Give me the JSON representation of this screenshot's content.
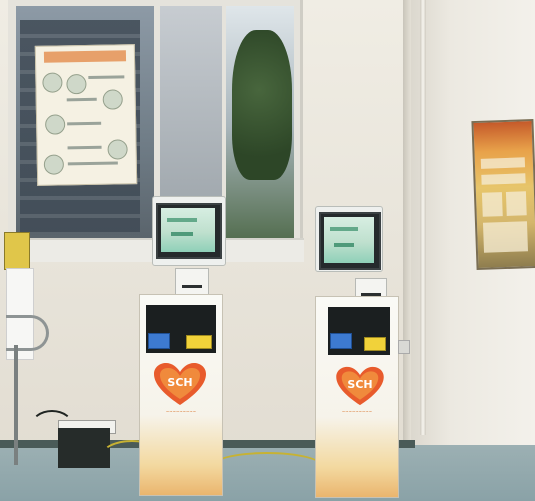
{
  "scene": {
    "description_label": "Hospital self-service kiosks",
    "colors": {
      "wall": "#ece9e1",
      "floor": "#8fa6ab",
      "kiosk_body": "#f8f6ee",
      "kiosk_wave": "#eab56e",
      "logo_heart": "#e85b2c",
      "screen": "#bfe0ce",
      "blue_tag": "#3d7ad1",
      "yellow_tag": "#f1d23a"
    }
  },
  "kiosks": [
    {
      "logo_text": "SCH",
      "has_screen": true,
      "has_printer": true
    },
    {
      "logo_text": "SCH",
      "has_screen": true,
      "has_printer": true
    }
  ],
  "icons": {
    "logo": "heart-logo-icon",
    "poster": "info-poster",
    "wall_poster": "bulletin-poster"
  }
}
